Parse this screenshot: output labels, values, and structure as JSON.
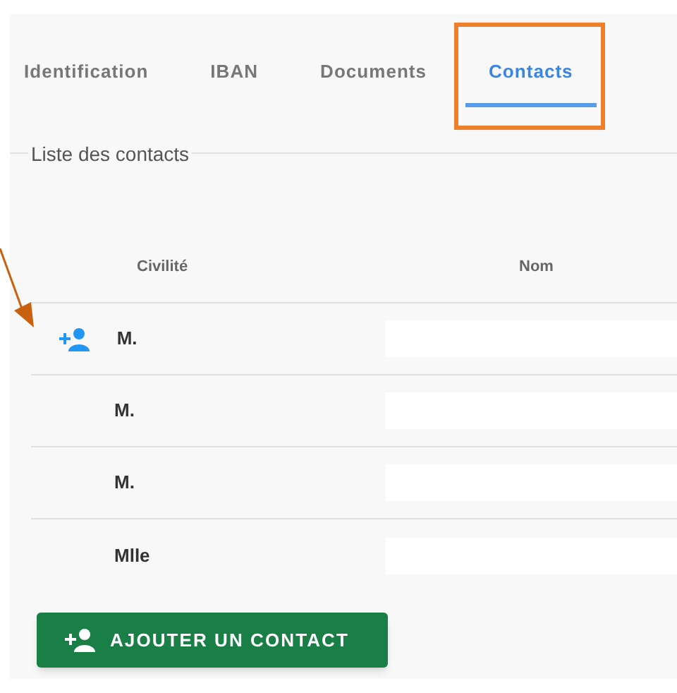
{
  "tabs": [
    {
      "label": "Identification",
      "selected": false,
      "highlighted": false
    },
    {
      "label": "IBAN",
      "selected": false,
      "highlighted": false
    },
    {
      "label": "Documents",
      "selected": false,
      "highlighted": false
    },
    {
      "label": "Contacts",
      "selected": true,
      "highlighted": true
    }
  ],
  "section_title": "Liste des contacts",
  "table": {
    "columns": [
      "Civilité",
      "Nom"
    ],
    "rows": [
      {
        "civilite": "M.",
        "add_icon": true,
        "pointed": true
      },
      {
        "civilite": "M.",
        "add_icon": false,
        "pointed": false
      },
      {
        "civilite": "M.",
        "add_icon": false,
        "pointed": false
      },
      {
        "civilite": "Mlle",
        "add_icon": false,
        "pointed": false
      }
    ]
  },
  "add_button": "AJOUTER UN CONTACT"
}
